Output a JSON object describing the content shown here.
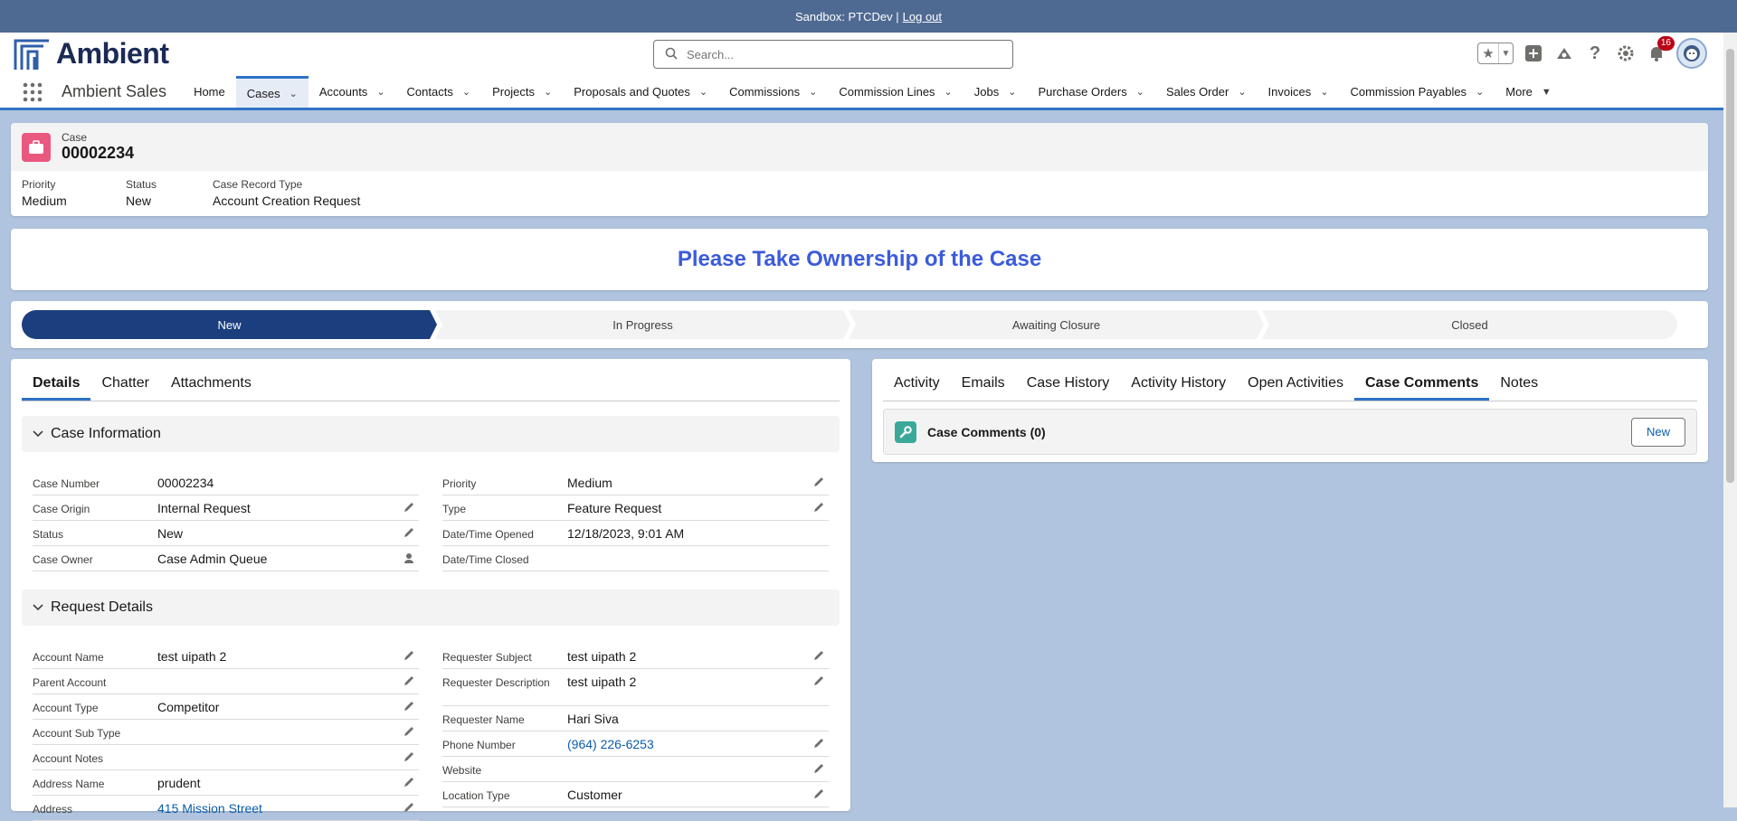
{
  "sandbox": {
    "text": "Sandbox: PTCDev |",
    "logout": "Log out"
  },
  "header": {
    "logo_text": "Ambient",
    "search_placeholder": "Search...",
    "notification_count": "16"
  },
  "nav": {
    "app_name": "Ambient Sales",
    "items": [
      "Home",
      "Cases",
      "Accounts",
      "Contacts",
      "Projects",
      "Proposals and Quotes",
      "Commissions",
      "Commission Lines",
      "Jobs",
      "Purchase Orders",
      "Sales Order",
      "Invoices",
      "Commission Payables",
      "More"
    ],
    "active": "Cases"
  },
  "record": {
    "object_label": "Case",
    "number": "00002234",
    "highlights": [
      {
        "label": "Priority",
        "value": "Medium"
      },
      {
        "label": "Status",
        "value": "New"
      },
      {
        "label": "Case Record Type",
        "value": "Account Creation Request"
      }
    ]
  },
  "banner": {
    "text": "Please Take Ownership of the Case"
  },
  "path": {
    "steps": [
      "New",
      "In Progress",
      "Awaiting Closure",
      "Closed"
    ],
    "current": "New"
  },
  "left_tabs": [
    "Details",
    "Chatter",
    "Attachments"
  ],
  "case_information": {
    "title": "Case Information",
    "left": [
      {
        "label": "Case Number",
        "value": "00002234"
      },
      {
        "label": "Case Origin",
        "value": "Internal Request"
      },
      {
        "label": "Status",
        "value": "New"
      },
      {
        "label": "Case Owner",
        "value": "Case Admin Queue"
      }
    ],
    "right": [
      {
        "label": "Priority",
        "value": "Medium"
      },
      {
        "label": "Type",
        "value": "Feature Request"
      },
      {
        "label": "Date/Time Opened",
        "value": "12/18/2023, 9:01 AM"
      },
      {
        "label": "Date/Time Closed",
        "value": ""
      }
    ]
  },
  "request_details": {
    "title": "Request Details",
    "left": [
      {
        "label": "Account Name",
        "value": "test uipath 2"
      },
      {
        "label": "Parent Account",
        "value": ""
      },
      {
        "label": "Account Type",
        "value": "Competitor"
      },
      {
        "label": "Account Sub Type",
        "value": ""
      },
      {
        "label": "Account Notes",
        "value": ""
      },
      {
        "label": "Address Name",
        "value": "prudent"
      },
      {
        "label": "Address",
        "value": "415 Mission Street"
      }
    ],
    "right": [
      {
        "label": "Requester Subject",
        "value": "test uipath 2"
      },
      {
        "label": "Requester Description",
        "value": "test uipath 2"
      },
      {
        "label": "Requester Name",
        "value": "Hari Siva"
      },
      {
        "label": "Phone Number",
        "value": "(964) 226-6253"
      },
      {
        "label": "Website",
        "value": ""
      },
      {
        "label": "Location Type",
        "value": "Customer"
      }
    ]
  },
  "right_tabs": [
    "Activity",
    "Emails",
    "Case History",
    "Activity History",
    "Open Activities",
    "Case Comments",
    "Notes"
  ],
  "case_comments": {
    "title": "Case Comments (0)",
    "new_button": "New"
  },
  "colors": {
    "brand_blue": "#2f72c6",
    "path_current": "#1b3f7e",
    "banner_text": "#3b5bdb",
    "case_icon": "#e9587f"
  }
}
